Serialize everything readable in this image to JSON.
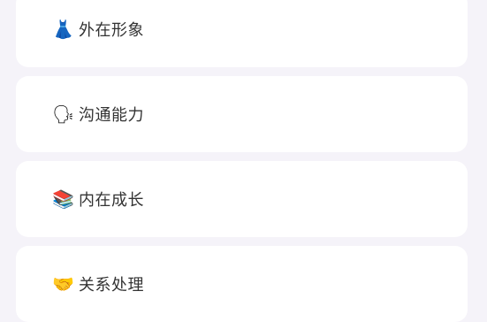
{
  "categories": [
    {
      "icon": "dress-icon",
      "emoji": "👗",
      "label": "外在形象"
    },
    {
      "icon": "speaking-head-icon",
      "emoji": "🗣",
      "label": "沟通能力"
    },
    {
      "icon": "books-icon",
      "emoji": "📚",
      "label": "内在成长"
    },
    {
      "icon": "handshake-icon",
      "emoji": "🤝",
      "label": "关系处理"
    }
  ],
  "colors": {
    "background": "#f5f3f9",
    "card": "#ffffff",
    "text": "#333333"
  }
}
